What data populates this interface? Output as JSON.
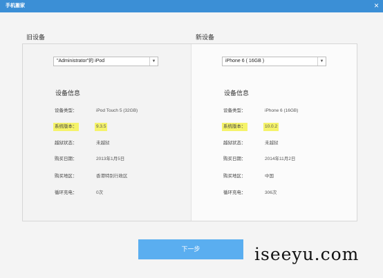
{
  "window": {
    "title": "手机搬家",
    "close_glyph": "×"
  },
  "old_device": {
    "heading": "旧设备",
    "selected": "\"Administrator\"的 iPod",
    "info_heading": "设备信息",
    "rows": [
      {
        "label": "设备类型：",
        "value": "iPod Touch 5 (32GB)"
      },
      {
        "label": "系统版本：",
        "value": "9.3.5"
      },
      {
        "label": "越狱状态：",
        "value": "未越狱"
      },
      {
        "label": "购买日期：",
        "value": "2013年1月5日"
      },
      {
        "label": "购买地区：",
        "value": "香港特别行政区"
      },
      {
        "label": "循环充电：",
        "value": "0次"
      }
    ]
  },
  "new_device": {
    "heading": "新设备",
    "selected": "iPhone 6 ( 16GB )",
    "info_heading": "设备信息",
    "rows": [
      {
        "label": "设备类型：",
        "value": "iPhone 6 (16GB)"
      },
      {
        "label": "系统版本：",
        "value": "10.0.2"
      },
      {
        "label": "越狱状态：",
        "value": "未越狱"
      },
      {
        "label": "购买日期：",
        "value": "2014年11月2日"
      },
      {
        "label": "购买地区：",
        "value": "中国"
      },
      {
        "label": "循环充电：",
        "value": "306次"
      }
    ]
  },
  "actions": {
    "next_label": "下一步"
  },
  "watermark": "iseeyu.com",
  "colors": {
    "titlebar": "#3b8fd6",
    "button": "#5aaef0",
    "highlight": "#f5f36a"
  }
}
